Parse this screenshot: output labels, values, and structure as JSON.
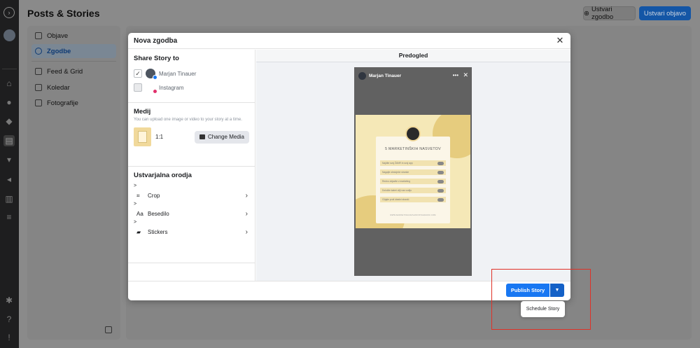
{
  "app": {
    "title": "Posts & Stories",
    "create_story_button": "Ustvari zgodbo",
    "create_post_button": "Ustvari objavo"
  },
  "sidebar": {
    "items": [
      {
        "label": "Objave",
        "icon": "posts-icon"
      },
      {
        "label": "Zgodbe",
        "icon": "stories-icon",
        "active": true
      },
      {
        "label": "Feed & Grid",
        "icon": "grid-icon"
      },
      {
        "label": "Koledar",
        "icon": "calendar-icon"
      },
      {
        "label": "Fotografije",
        "icon": "photos-icon"
      }
    ]
  },
  "modal": {
    "title": "Nova zgodba",
    "share": {
      "title": "Share Story to",
      "accounts": [
        {
          "name": "Marjan Tinauer",
          "checked": true,
          "platform": "facebook"
        },
        {
          "name": "Instagram",
          "checked": false,
          "platform": "instagram"
        }
      ]
    },
    "media": {
      "title": "Medij",
      "hint": "You can upload one image or video to your story at a time.",
      "ratio": "1:1",
      "change_button": "Change Media"
    },
    "tools": {
      "title": "Ustvarjalna orodja",
      "items": [
        {
          "prefix": ">",
          "label": "Crop",
          "icon": "crop-icon"
        },
        {
          "prefix": ">",
          "label": "Besedilo",
          "icon": "text-icon",
          "icon_text": "Aa"
        },
        {
          "prefix": ">",
          "label": "Stickers",
          "icon": "sticker-icon"
        }
      ]
    },
    "preview": {
      "label": "Predogled",
      "account_name": "Marjan Tinauer",
      "story_title": "5 MARKETINŠKIH NASVETOV",
      "tips": [
        "Najdite svoj ŽANR in svoj app",
        "Nagajte obstoječe stranke",
        "Redno objavite v marketing",
        "Določite kateri cilji vas vodijo",
        "Ciljajte proti idealni stranki"
      ],
      "footer_url": "WWW.MARKETINGNAPLANINSTAGRAMU.COM"
    },
    "publish_button": "Publish Story",
    "dropdown_item": "Schedule Story"
  },
  "colors": {
    "accent": "#1877f2",
    "highlight": "#e03127"
  }
}
